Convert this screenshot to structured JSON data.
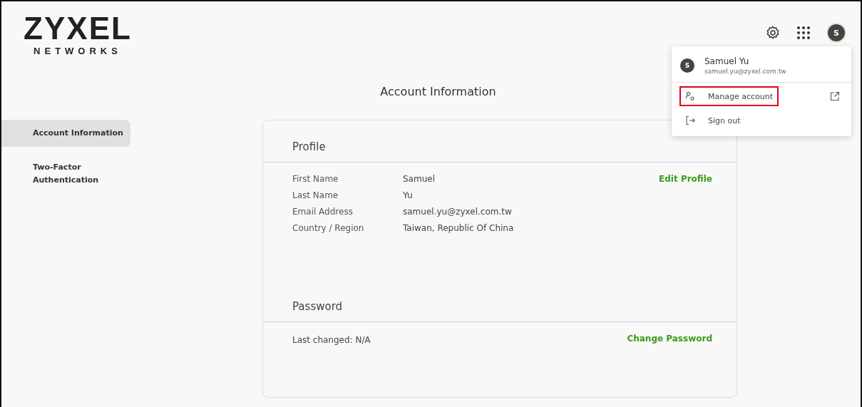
{
  "logo": {
    "brand": "ZYXEL",
    "tagline": "NETWORKS"
  },
  "header": {
    "avatar_letter": "S"
  },
  "page_title": "Account Information",
  "sidebar": {
    "items": [
      {
        "label": "Account Information",
        "selected": true
      },
      {
        "label": "Two-Factor Authentication",
        "selected": false
      }
    ]
  },
  "profile": {
    "title": "Profile",
    "action": "Edit Profile",
    "fields": [
      {
        "label": "First Name",
        "value": "Samuel"
      },
      {
        "label": "Last Name",
        "value": "Yu"
      },
      {
        "label": "Email Address",
        "value": "samuel.yu@zyxel.com.tw"
      },
      {
        "label": "Country / Region",
        "value": "Taiwan, Republic Of China"
      }
    ]
  },
  "password": {
    "title": "Password",
    "last_changed": "Last changed: N/A",
    "action": "Change Password"
  },
  "account_menu": {
    "avatar_letter": "S",
    "name": "Samuel Yu",
    "email": "samuel.yu@zyxel.com.tw",
    "items": [
      {
        "kind": "manage",
        "label": "Manage account",
        "highlighted": true,
        "external": true
      },
      {
        "kind": "signout",
        "label": "Sign out",
        "highlighted": false,
        "external": false
      }
    ]
  }
}
